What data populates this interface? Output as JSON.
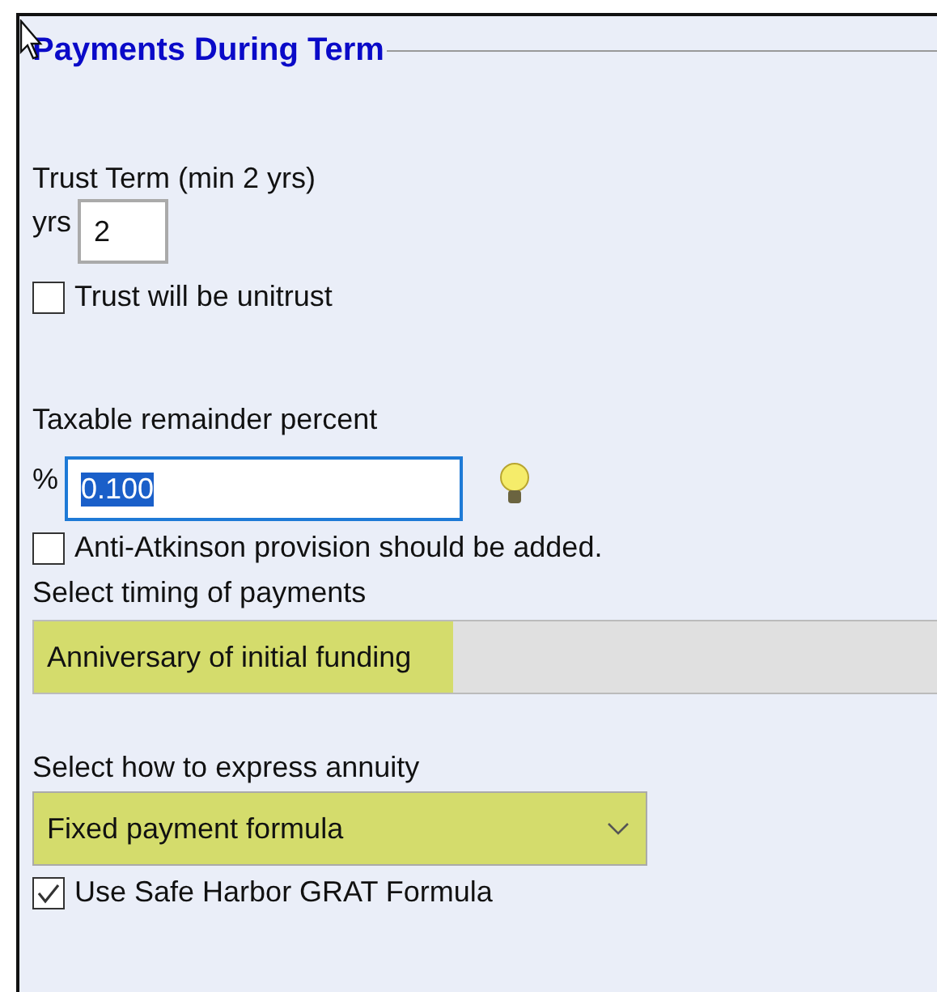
{
  "section": {
    "title": "Payments During Term"
  },
  "fields": [
    {
      "kind": "number",
      "label": "Trust Term (min 2 yrs)",
      "prefix": "yrs",
      "value": "2",
      "selected_text": false,
      "hint": false
    },
    {
      "kind": "checkbox",
      "label": "Trust will be unitrust",
      "checked": false
    },
    {
      "kind": "number",
      "label": "Taxable remainder percent",
      "prefix": "%",
      "value": "0.100",
      "selected_text": true,
      "hint": true
    },
    {
      "kind": "checkbox",
      "label": "Anti-Atkinson provision should be added.",
      "checked": false
    },
    {
      "kind": "display",
      "label": "Select timing of payments",
      "value": "Anniversary of initial funding",
      "highlighted": true
    },
    {
      "kind": "dropdown",
      "label": "Select how to express annuity",
      "value": "Fixed payment formula",
      "highlighted": true
    },
    {
      "kind": "checkbox",
      "label": "Use Safe Harbor GRAT Formula",
      "checked": true
    }
  ]
}
